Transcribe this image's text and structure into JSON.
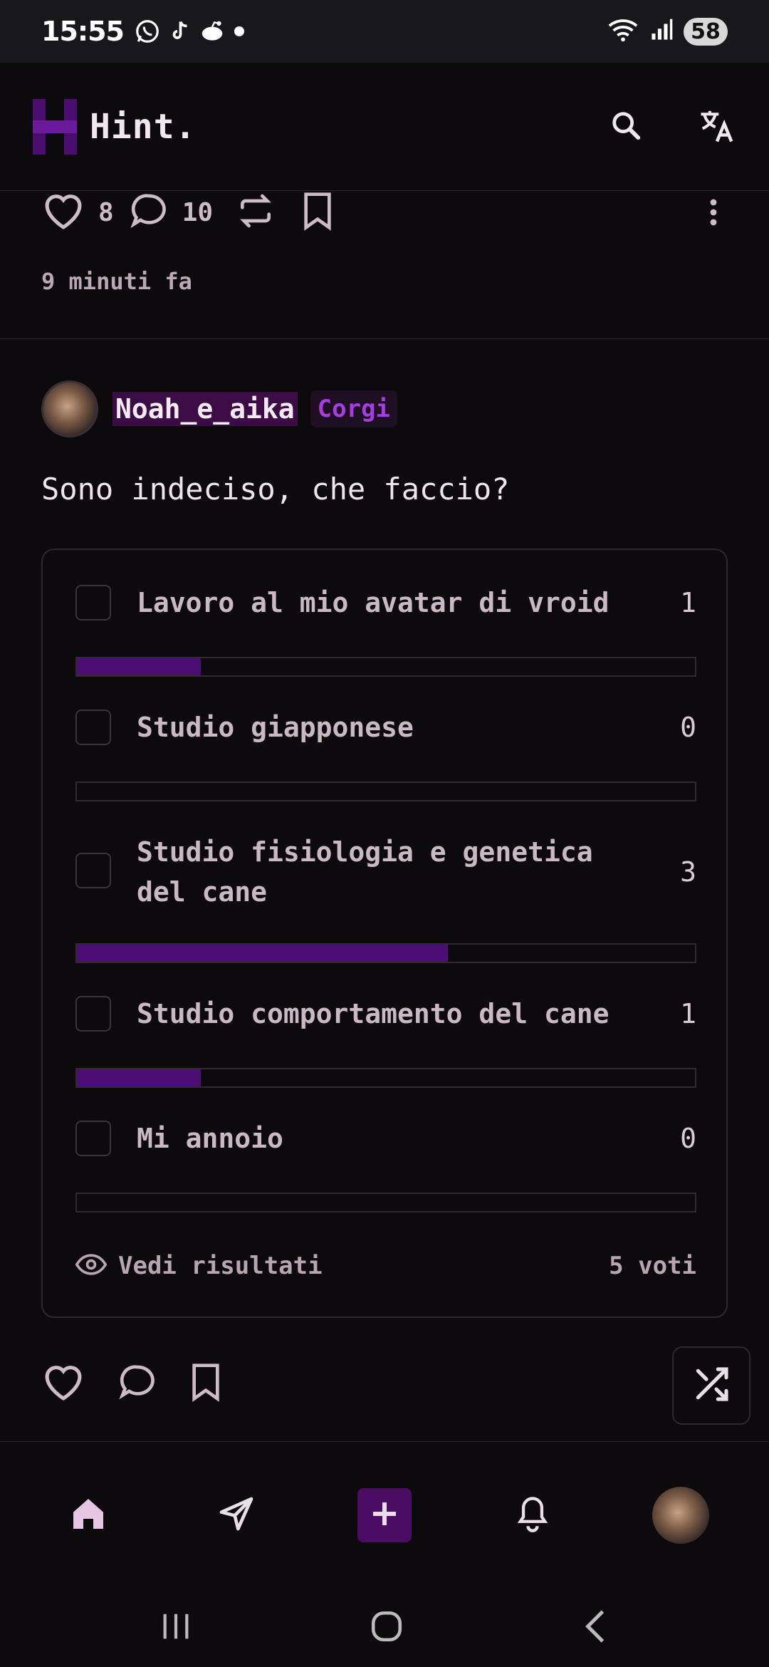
{
  "status_bar": {
    "time": "15:55",
    "battery": "58",
    "app_icons": [
      "whatsapp-icon",
      "tiktok-icon",
      "reddit-icon",
      "dot-icon"
    ]
  },
  "app_bar": {
    "title": "Hint.",
    "icons": [
      "search-icon",
      "translate-icon"
    ]
  },
  "previous_post": {
    "likes": "8",
    "comments": "10",
    "time_ago": "9 minuti fa"
  },
  "post": {
    "username": "Noah_e_aika",
    "badge": "Corgi",
    "text": "Sono indeciso, che faccio?",
    "poll": {
      "options": [
        {
          "label": "Lavoro al mio avatar di vroid",
          "count": "1",
          "fraction": 0.2
        },
        {
          "label": "Studio giapponese",
          "count": "0",
          "fraction": 0
        },
        {
          "label": "Studio fisiologia e genetica del cane",
          "count": "3",
          "fraction": 0.6
        },
        {
          "label": "Studio comportamento del cane",
          "count": "1",
          "fraction": 0.2
        },
        {
          "label": "Mi annoio",
          "count": "0",
          "fraction": 0
        }
      ],
      "see_results": "Vedi risultati",
      "votes": "5 voti"
    }
  },
  "colors": {
    "accent": "#4c0e72",
    "badge_text": "#a53de0",
    "background": "#0c0a0c"
  }
}
